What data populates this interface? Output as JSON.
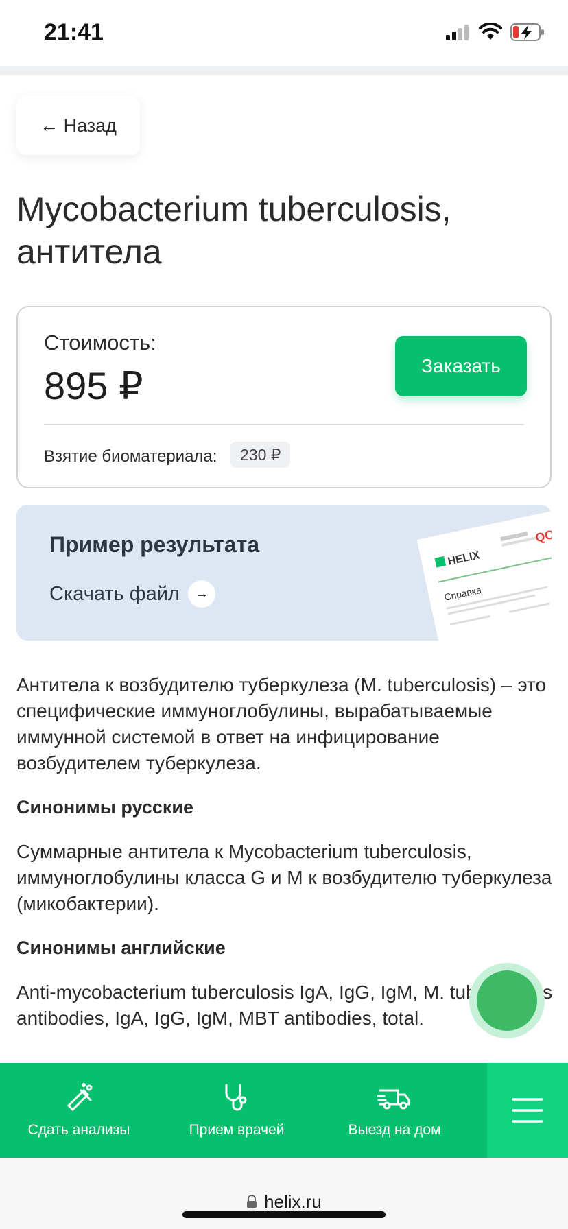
{
  "status_bar": {
    "time": "21:41"
  },
  "back_button": {
    "label": "← Назад"
  },
  "page_title": "Mycobacterium tuberculosis, антитела",
  "price_card": {
    "cost_label": "Стоимость:",
    "price": "895 ₽",
    "order_label": "Заказать",
    "biomaterial_label": "Взятие биоматериала:",
    "biomaterial_price": "230 ₽"
  },
  "sample_card": {
    "title": "Пример результата",
    "download_label": "Скачать файл",
    "preview_brand": "HELIX",
    "preview_doc_title": "Справка"
  },
  "description": {
    "intro": "Антитела к возбудителю туберкулеза (M. tuberculosis) – это специфические иммуноглобулины, вырабатываемые иммунной системой в ответ на инфицирование возбудителем туберкулеза.",
    "synonyms_ru_heading": "Синонимы русские",
    "synonyms_ru": "Суммарные антитела к Mycobacterium tuberculosis, иммуноглобулины класса G и M к возбудителю туберкулеза (микобактерии).",
    "synonyms_en_heading": "Синонимы английские",
    "synonyms_en": "Anti-mycobacterium tuberculosis IgA, IgG, IgM, M. tuberculosis antibodies, IgA, IgG, IgM, MBT antibodies, total."
  },
  "bottom_nav": {
    "items": [
      {
        "label": "Сдать анализы",
        "icon": "test-tube-icon"
      },
      {
        "label": "Прием врачей",
        "icon": "stethoscope-icon"
      },
      {
        "label": "Выезд на дом",
        "icon": "truck-icon"
      }
    ],
    "menu_icon": "hamburger-menu-icon"
  },
  "browser": {
    "url": "helix.ru"
  },
  "colors": {
    "brand_green": "#06c06e",
    "sample_bg": "#dde6f3"
  }
}
